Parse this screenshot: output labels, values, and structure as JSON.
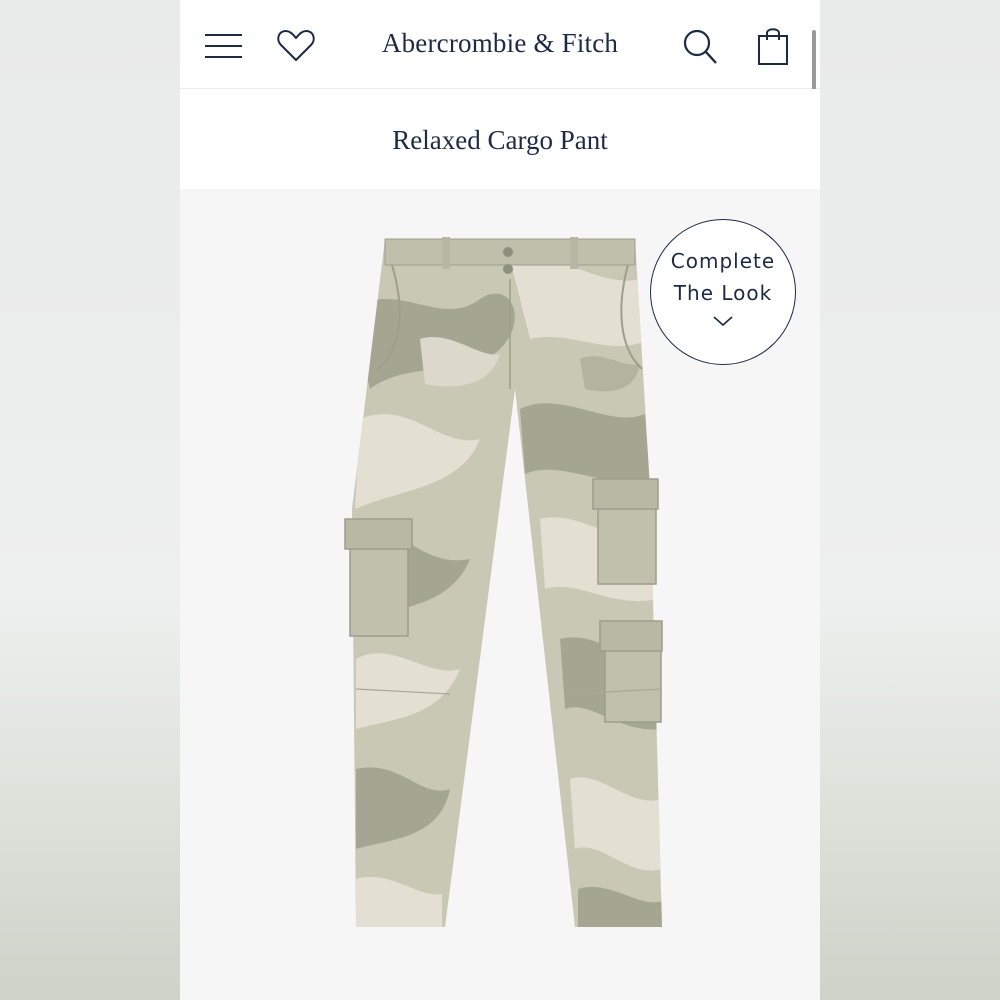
{
  "header": {
    "brand": "Abercrombie & Fitch",
    "menu_icon": "hamburger-menu-icon",
    "wishlist_icon": "heart-icon",
    "search_icon": "search-icon",
    "bag_icon": "shopping-bag-icon"
  },
  "product": {
    "title": "Relaxed Cargo Pant"
  },
  "complete_the_look": {
    "line1": "Complete",
    "line2": "The Look",
    "icon": "chevron-down-icon"
  },
  "colors": {
    "brand_navy": "#1d2a44",
    "camo_base": "#c9c8b5",
    "camo_dark": "#a5a692",
    "camo_light": "#e3dfd3"
  }
}
